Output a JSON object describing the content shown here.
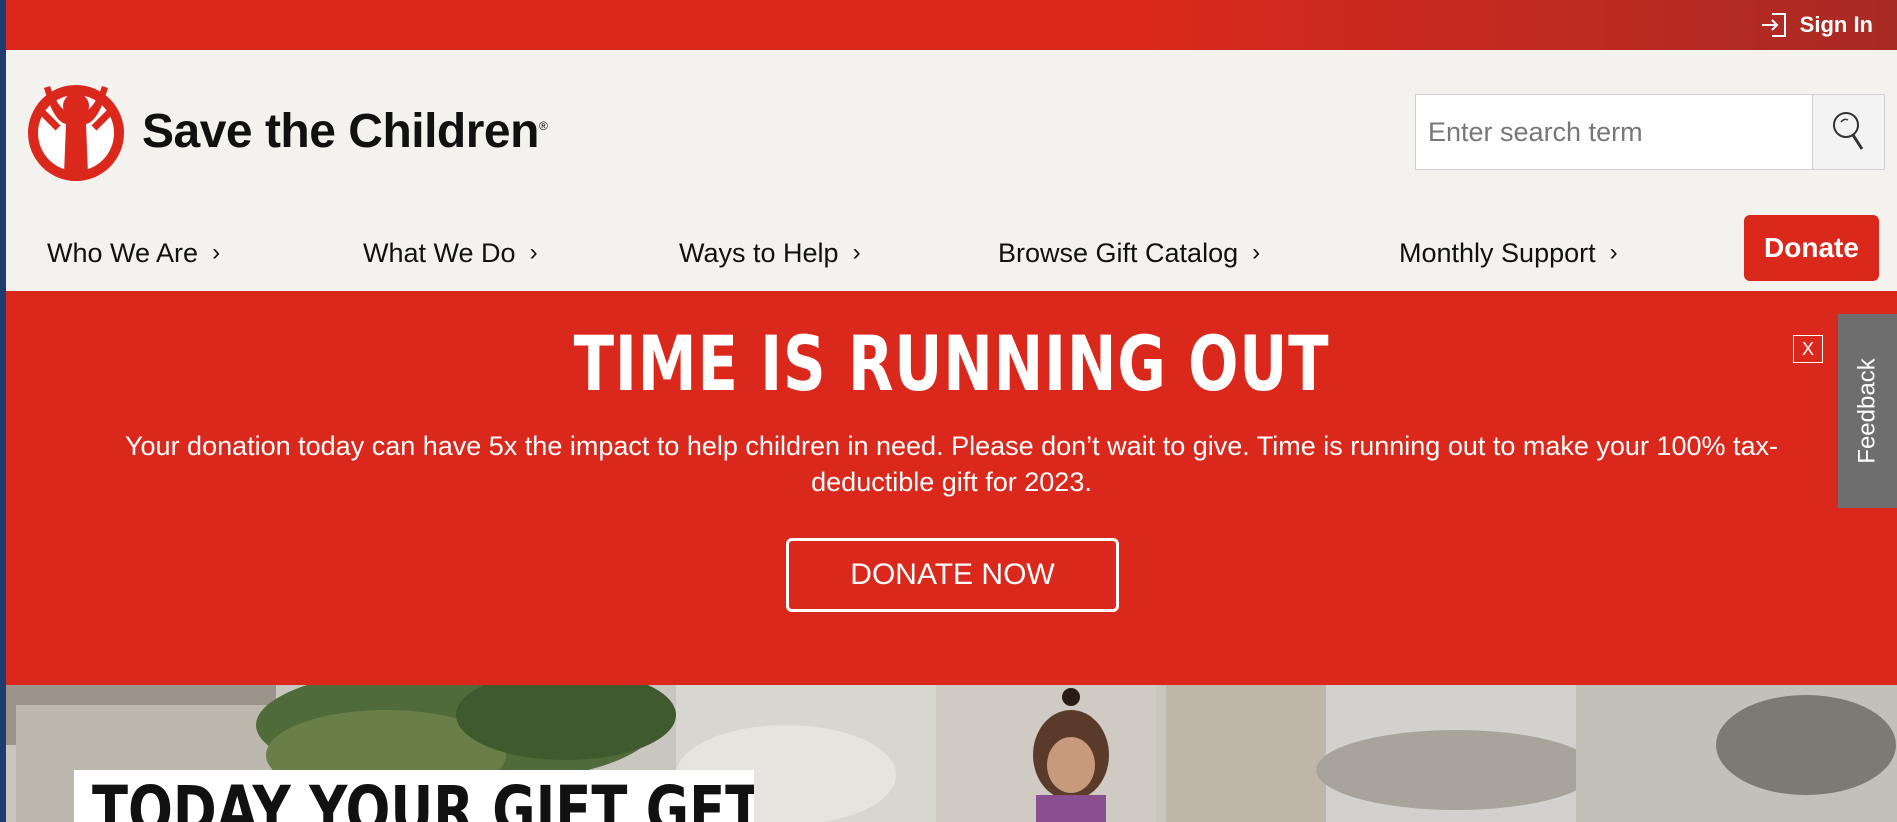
{
  "topbar": {
    "sign_in_label": "Sign In",
    "icon": "sign-in-icon"
  },
  "brand": {
    "name": "Save the Children",
    "registered_mark": "®",
    "primary_color": "#da291c"
  },
  "search": {
    "placeholder": "Enter search term",
    "value": "",
    "icon": "search-icon"
  },
  "nav": {
    "items": [
      {
        "label": "Who We Are",
        "chevron": "›"
      },
      {
        "label": "What We Do",
        "chevron": "›"
      },
      {
        "label": "Ways to Help",
        "chevron": "›"
      },
      {
        "label": "Browse Gift Catalog",
        "chevron": "›"
      },
      {
        "label": "Monthly Support",
        "chevron": "›"
      }
    ],
    "donate_label": "Donate"
  },
  "banner": {
    "title": "TIME IS RUNNING OUT",
    "text": "Your donation today can have 5x the impact to help children in need. Please don’t wait to give. Time is running out to make your 100% tax-deductible gift for 2023.",
    "cta_label": "DONATE NOW",
    "close_label": "X"
  },
  "feedback": {
    "label": "Feedback"
  },
  "hero": {
    "headline": "TODAY YOUR GIFT GETS"
  }
}
